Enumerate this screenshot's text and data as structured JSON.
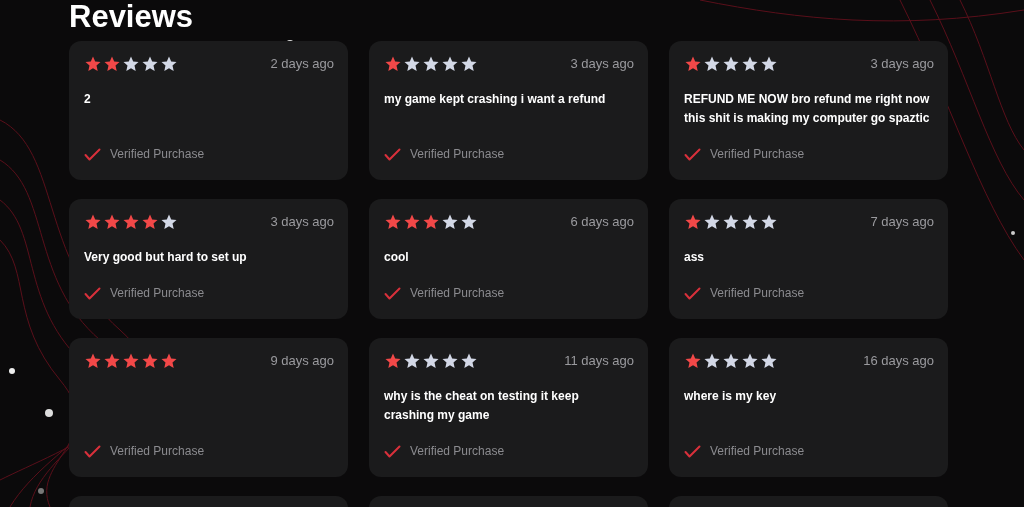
{
  "title": "Reviews",
  "reviews": [
    {
      "stars": 2,
      "date": "2 days ago",
      "text": "2",
      "badge": "Verified Purchase"
    },
    {
      "stars": 1,
      "date": "3 days ago",
      "text": "my game kept crashing i want a refund",
      "badge": "Verified Purchase"
    },
    {
      "stars": 1,
      "date": "3 days ago",
      "text": "REFUND ME NOW bro refund me right now this shit is making my computer go spaztic",
      "badge": "Verified Purchase"
    },
    {
      "stars": 4,
      "date": "3 days ago",
      "text": "Very good but hard to set up",
      "badge": "Verified Purchase"
    },
    {
      "stars": 3,
      "date": "6 days ago",
      "text": "cool",
      "badge": "Verified Purchase"
    },
    {
      "stars": 1,
      "date": "7 days ago",
      "text": "ass",
      "badge": "Verified Purchase"
    },
    {
      "stars": 5,
      "date": "9 days ago",
      "badge": "Verified Purchase"
    },
    {
      "stars": 1,
      "date": "11 days ago",
      "text": "why is the cheat on testing it keep crashing my game",
      "badge": "Verified Purchase"
    },
    {
      "stars": 1,
      "date": "16 days ago",
      "text": "where is my key",
      "badge": "Verified Purchase"
    }
  ],
  "partial_reviews": [
    {
      "kind": "card"
    },
    {
      "kind": "card"
    },
    {
      "kind": "card"
    }
  ]
}
